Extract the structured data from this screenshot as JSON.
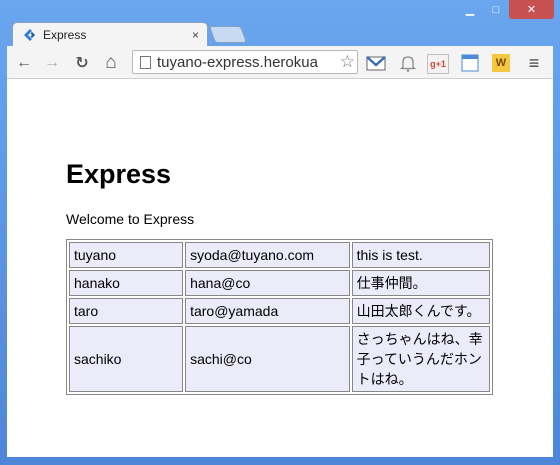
{
  "window": {
    "controls": [
      "minimize",
      "maximize",
      "close"
    ]
  },
  "tab": {
    "title": "Express",
    "close_glyph": "×",
    "favicon": "express-favicon-icon"
  },
  "toolbar": {
    "back_icon": "←",
    "forward_icon": "→",
    "reload_icon": "↻",
    "home_icon": "⌂",
    "url": "tuyano-express.herokua",
    "bookmark_icon": "☆",
    "extensions": [
      "gmail-icon",
      "bell-icon",
      "google-plus-icon",
      "calendar-icon",
      "w-extension-icon"
    ],
    "google_plus_label": "g+1",
    "w_label": "W",
    "menu_icon": "≡"
  },
  "page": {
    "heading": "Express",
    "welcome": "Welcome to Express",
    "rows": [
      {
        "name": "tuyano",
        "email": "syoda@tuyano.com",
        "memo": "this is test."
      },
      {
        "name": "hanako",
        "email": "hana@co",
        "memo": "仕事仲間。"
      },
      {
        "name": "taro",
        "email": "taro@yamada",
        "memo": "山田太郎くんです。"
      },
      {
        "name": "sachiko",
        "email": "sachi@co",
        "memo": "さっちゃんはね、幸子っていうんだホントはね。"
      }
    ]
  }
}
